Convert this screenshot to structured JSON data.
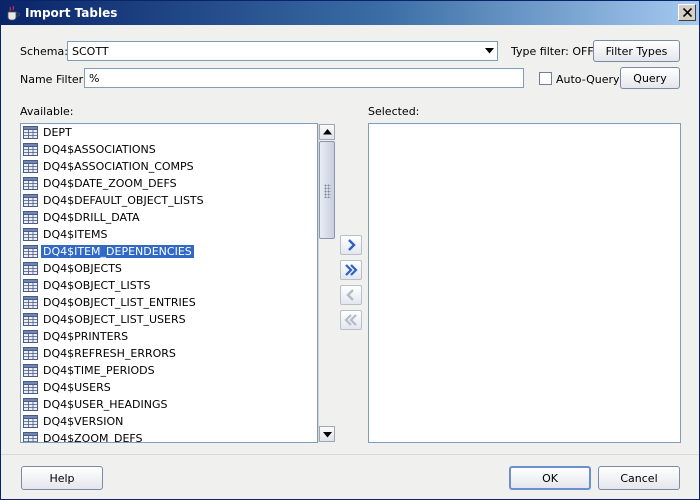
{
  "window": {
    "title": "Import Tables"
  },
  "schema": {
    "label": "Schema:",
    "value": "SCOTT"
  },
  "type_filter": {
    "status": "Type filter: OFF",
    "button": "Filter Types"
  },
  "name_filter": {
    "label": "Name Filter:",
    "value": "%"
  },
  "auto_query": {
    "label": "Auto-Query",
    "checked": false
  },
  "query_button": "Query",
  "available": {
    "label": "Available:",
    "items": [
      "DEPT",
      "DQ4$ASSOCIATIONS",
      "DQ4$ASSOCIATION_COMPS",
      "DQ4$DATE_ZOOM_DEFS",
      "DQ4$DEFAULT_OBJECT_LISTS",
      "DQ4$DRILL_DATA",
      "DQ4$ITEMS",
      "DQ4$ITEM_DEPENDENCIES",
      "DQ4$OBJECTS",
      "DQ4$OBJECT_LISTS",
      "DQ4$OBJECT_LIST_ENTRIES",
      "DQ4$OBJECT_LIST_USERS",
      "DQ4$PRINTERS",
      "DQ4$REFRESH_ERRORS",
      "DQ4$TIME_PERIODS",
      "DQ4$USERS",
      "DQ4$USER_HEADINGS",
      "DQ4$VERSION",
      "DQ4$ZOOM_DEFS"
    ],
    "selected_item": "DQ4$ITEM_DEPENDENCIES"
  },
  "selected": {
    "label": "Selected:",
    "items": []
  },
  "buttons": {
    "help": "Help",
    "ok": "OK",
    "cancel": "Cancel"
  },
  "colors": {
    "selection": "#3169c6",
    "title_bar": "#0a246a",
    "move_arrow": "#2a62c9"
  }
}
